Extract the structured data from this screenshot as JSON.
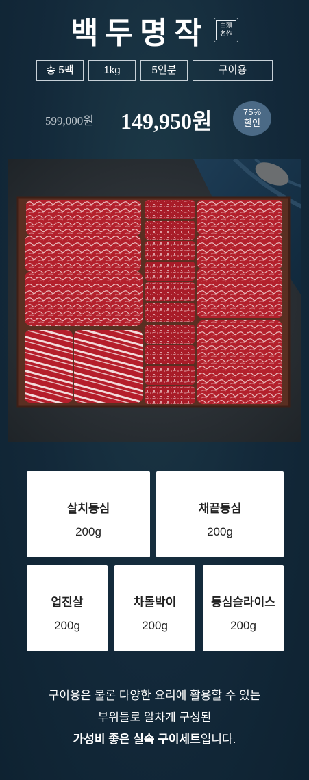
{
  "brand": {
    "title": "백두명작",
    "seal_top": "白頭",
    "seal_bottom": "名作"
  },
  "tags": [
    "총 5팩",
    "1kg",
    "5인분",
    "구이용"
  ],
  "price": {
    "original": "599,000원",
    "sale": "149,950원",
    "discount_line1": "75%",
    "discount_line2": "할인"
  },
  "cuts": [
    {
      "name": "살치등심",
      "weight": "200g"
    },
    {
      "name": "채끝등심",
      "weight": "200g"
    },
    {
      "name": "업진살",
      "weight": "200g"
    },
    {
      "name": "차돌박이",
      "weight": "200g"
    },
    {
      "name": "등심슬라이스",
      "weight": "200g"
    }
  ],
  "description": {
    "line1": "구이용은 물론 다양한 요리에 활용할 수 있는",
    "line2": "부위들로 알차게 구성된",
    "line3_bold": "가성비 좋은 실속 구이세트",
    "line3_rest": "입니다."
  }
}
